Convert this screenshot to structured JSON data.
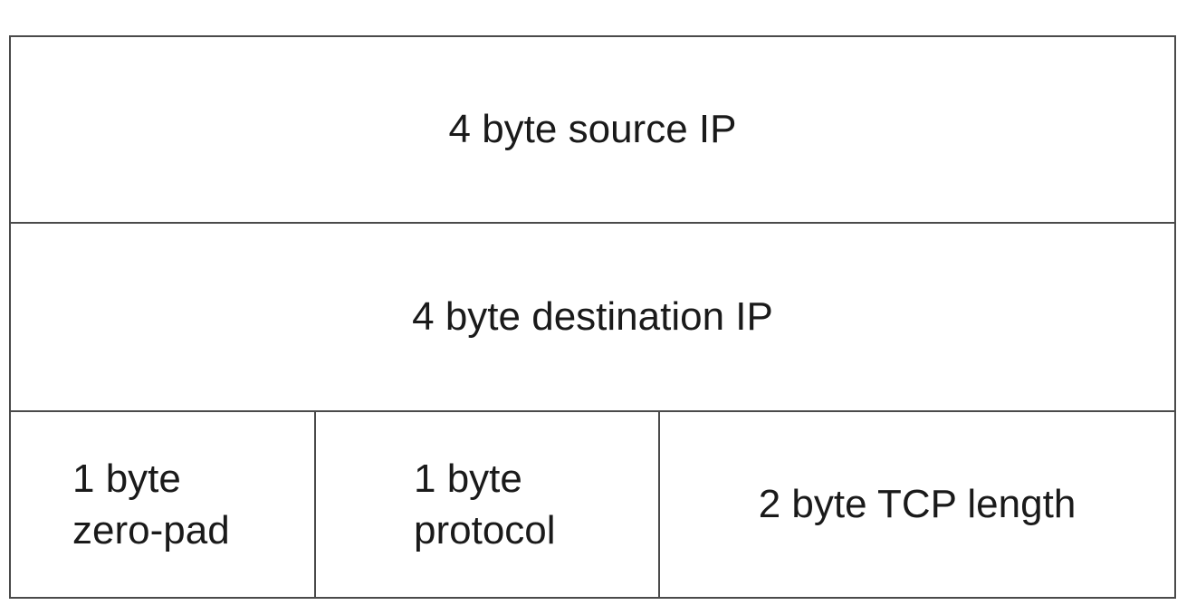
{
  "fields": {
    "source_ip": "4 byte source IP",
    "destination_ip": "4 byte destination IP",
    "zero_pad": {
      "line1": "1 byte",
      "line2": "zero-pad"
    },
    "protocol": {
      "line1": "1 byte",
      "line2": "protocol"
    },
    "tcp_length": "2 byte TCP length"
  }
}
